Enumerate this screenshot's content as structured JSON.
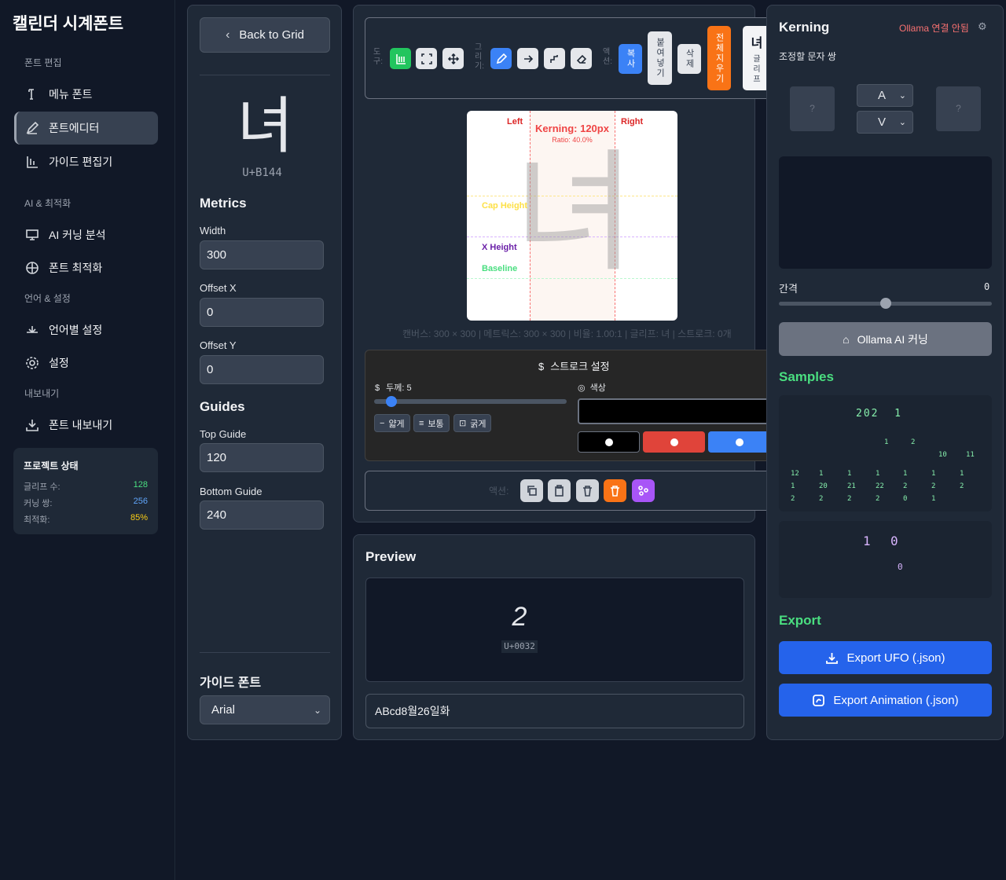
{
  "app_title": "캘린더 시계폰트",
  "sidebar": {
    "sections": [
      "폰트 편집",
      "AI & 최적화",
      "언어 & 설정",
      "내보내기"
    ],
    "items": [
      {
        "label": "메뉴 폰트",
        "icon": "menu-font-icon"
      },
      {
        "label": "폰트에디터",
        "icon": "pen-icon"
      },
      {
        "label": "가이드 편집기",
        "icon": "guide-icon"
      },
      {
        "label": "AI 커닝 분석",
        "icon": "monitor-icon"
      },
      {
        "label": "폰트 최적화",
        "icon": "crosshair-icon"
      },
      {
        "label": "언어별 설정",
        "icon": "language-icon"
      },
      {
        "label": "설정",
        "icon": "gear-icon"
      },
      {
        "label": "폰트 내보내기",
        "icon": "download-icon"
      }
    ],
    "status": {
      "title": "프로젝트 상태",
      "rows": [
        {
          "label": "글리프 수:",
          "value": "128",
          "color": "#4ade80"
        },
        {
          "label": "커닝 쌍:",
          "value": "256",
          "color": "#60a5fa"
        },
        {
          "label": "최적화:",
          "value": "85%",
          "color": "#facc15"
        }
      ]
    }
  },
  "left_panel": {
    "back_label": "Back to Grid",
    "glyph": "녀",
    "glyph_code": "U+B144",
    "metrics_title": "Metrics",
    "width_label": "Width",
    "width_value": "300",
    "offset_x_label": "Offset X",
    "offset_x_value": "0",
    "offset_y_label": "Offset Y",
    "offset_y_value": "0",
    "guides_title": "Guides",
    "top_guide_label": "Top Guide",
    "top_guide_value": "120",
    "bottom_guide_label": "Bottom Guide",
    "bottom_guide_value": "240",
    "guide_font_title": "가이드 폰트",
    "guide_font_value": "Arial"
  },
  "toolbar": {
    "tool_label": "도구:",
    "draw_label": "그리기:",
    "action_label": "액션:",
    "copy": "복사",
    "paste": "붙여넣기",
    "delete": "삭제",
    "clear_all": "전체지우기",
    "glyph_preview": "녀",
    "glyph_preview_sub": "글리프"
  },
  "canvas": {
    "left": "Left",
    "right": "Right",
    "kerning": "Kerning: 120px",
    "ratio": "Ratio: 40.0%",
    "cap_height": "Cap Height",
    "x_height": "X Height",
    "baseline": "Baseline",
    "glyph": "녀",
    "info": "캔버스: 300 × 300 | 메트릭스: 300 × 300 | 비율: 1.00:1 | 글리프: 녀 | 스트로크: 0개"
  },
  "stroke": {
    "title": "스트로크 설정",
    "thickness_label": "두께: 5",
    "thickness_fraction": 0.09,
    "thin": "얇게",
    "normal": "보통",
    "thick": "굵게",
    "color_label": "색상",
    "colors": [
      "#000000",
      "#e0443a",
      "#3b82f6"
    ]
  },
  "actions": {
    "label": "액션:"
  },
  "preview": {
    "title": "Preview",
    "char": "2",
    "code": "U+0032",
    "input_value": "ABcd8월26일화"
  },
  "kerning": {
    "title": "Kerning",
    "ollama_status": "Ollama 연결 안됨",
    "subtitle": "조정할 문자 쌍",
    "left_placeholder": "?",
    "right_placeholder": "?",
    "char_a": "A",
    "char_b": "V",
    "spacing_label": "간격",
    "spacing_value": "0",
    "spacing_fraction": 0.5,
    "ai_button": "Ollama AI 커닝"
  },
  "samples": {
    "title": "Samples",
    "line1": "202  1",
    "row_a": [
      "1",
      "2"
    ],
    "row_b": [
      "10",
      "11"
    ],
    "grid": [
      [
        "12",
        "1",
        "1",
        "1",
        "1",
        "1",
        "1"
      ],
      [
        "1",
        "20",
        "21",
        "22",
        "2",
        "2",
        "2"
      ],
      [
        "2",
        "2",
        "2",
        "2",
        "0",
        "1",
        ""
      ]
    ],
    "sample2_top": [
      "1",
      "0"
    ],
    "sample2_bottom": "0"
  },
  "export": {
    "title": "Export",
    "ufo": "Export UFO (.json)",
    "animation": "Export Animation (.json)"
  }
}
